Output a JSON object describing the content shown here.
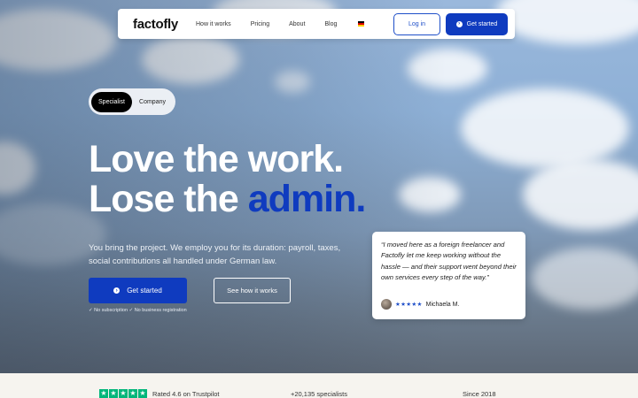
{
  "nav": {
    "logo": "factofly",
    "links": [
      "How it works",
      "Pricing",
      "About",
      "Blog"
    ],
    "language_icon": "german-flag-icon",
    "login_label": "Log in",
    "get_started_label": "Get started"
  },
  "toggle": {
    "options": [
      "Specialist",
      "Company"
    ],
    "selected": "Specialist"
  },
  "hero": {
    "line1": "Love the work.",
    "line2_plain": "Lose the ",
    "line2_accent": "admin.",
    "lead": "You bring the project. We employ you for its duration: payroll, taxes, social contributions all handled under German law.",
    "primary_cta": "Get started",
    "secondary_cta": "See how it works",
    "fineprint": "✓ No subscription ✓ No business registration"
  },
  "testimonial": {
    "quote": "“I moved here as a foreign freelancer and Factofly let me keep working without the hassle — and their support went beyond their own services every step of the way.”",
    "rating_stars": "★★★★★",
    "author": "Michaela M."
  },
  "trust_band": {
    "trustpilot": "Rated 4.6 on Trustpilot",
    "specialists": "+20,135 specialists",
    "since": "Since 2018"
  },
  "colors": {
    "accent": "#0f3bbf",
    "trustpilot_green": "#00b67a"
  }
}
